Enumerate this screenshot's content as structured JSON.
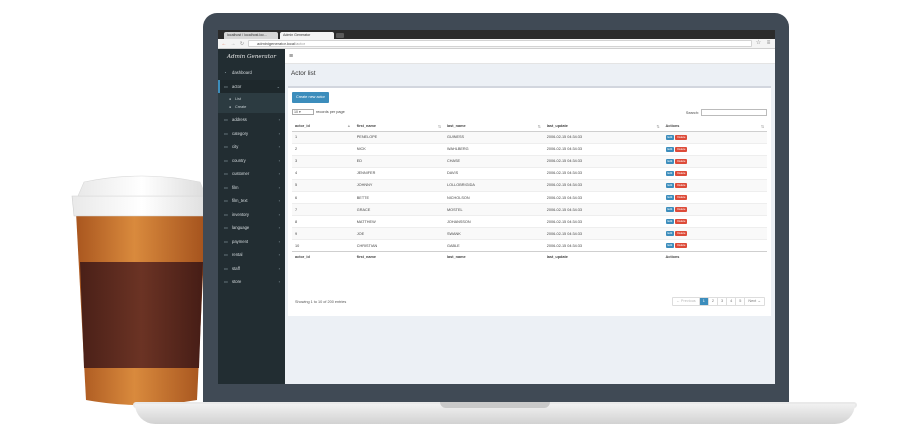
{
  "browser": {
    "tabs": [
      {
        "label": "localhost / localhost.loc..."
      },
      {
        "label": "Admin Generator"
      }
    ],
    "url_host": "adminigenerator.local",
    "url_path": "/actor"
  },
  "sidebar": {
    "brand": "Admin Generator",
    "items": [
      {
        "label": "dashboard"
      },
      {
        "label": "actor"
      },
      {
        "label": "address"
      },
      {
        "label": "category"
      },
      {
        "label": "city"
      },
      {
        "label": "country"
      },
      {
        "label": "customer"
      },
      {
        "label": "film"
      },
      {
        "label": "film_text"
      },
      {
        "label": "inventory"
      },
      {
        "label": "language"
      },
      {
        "label": "payment"
      },
      {
        "label": "rental"
      },
      {
        "label": "staff"
      },
      {
        "label": "store"
      }
    ],
    "sub_items": [
      {
        "label": "List"
      },
      {
        "label": "Create"
      }
    ]
  },
  "page": {
    "title": "Actor list",
    "create_button": "Create new actor",
    "length_value": "10",
    "length_suffix": "records per page",
    "search_label": "Search:",
    "columns": [
      "actor_id",
      "first_name",
      "last_name",
      "last_update",
      "Actions"
    ],
    "rows": [
      {
        "id": "1",
        "first": "PENELOPE",
        "last": "GUINESS",
        "updated": "2006-02-15 04:34:33"
      },
      {
        "id": "2",
        "first": "NICK",
        "last": "WAHLBERG",
        "updated": "2006-02-15 04:34:33"
      },
      {
        "id": "3",
        "first": "ED",
        "last": "CHASE",
        "updated": "2006-02-15 04:34:33"
      },
      {
        "id": "4",
        "first": "JENNIFER",
        "last": "DAVIS",
        "updated": "2006-02-15 04:34:33"
      },
      {
        "id": "5",
        "first": "JOHNNY",
        "last": "LOLLOBRIGIDA",
        "updated": "2006-02-15 04:34:33"
      },
      {
        "id": "6",
        "first": "BETTE",
        "last": "NICHOLSON",
        "updated": "2006-02-15 04:34:33"
      },
      {
        "id": "7",
        "first": "GRACE",
        "last": "MOSTEL",
        "updated": "2006-02-15 04:34:33"
      },
      {
        "id": "8",
        "first": "MATTHEW",
        "last": "JOHANSSON",
        "updated": "2006-02-15 04:34:33"
      },
      {
        "id": "9",
        "first": "JOE",
        "last": "SWANK",
        "updated": "2006-02-15 04:34:33"
      },
      {
        "id": "10",
        "first": "CHRISTIAN",
        "last": "GABLE",
        "updated": "2006-02-15 04:34:33"
      }
    ],
    "edit_label": "Edit",
    "delete_label": "Delete",
    "info": "Showing 1 to 10 of 200 entries",
    "pagination": {
      "previous": "← Previous",
      "pages": [
        "1",
        "2",
        "3",
        "4",
        "5"
      ],
      "next": "Next →"
    }
  },
  "colors": {
    "accent": "#3c8dbc",
    "danger": "#dd4b39",
    "sidebar": "#222d32",
    "cup_sleeve": "#5a2a20",
    "cup_body": "#c8722e"
  }
}
